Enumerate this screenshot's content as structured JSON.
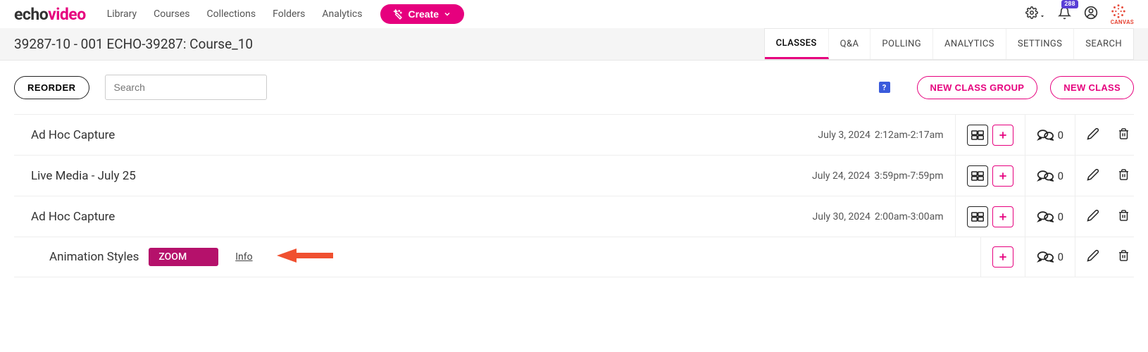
{
  "brand": {
    "part1": "echo",
    "part2": "video"
  },
  "nav": {
    "links": [
      "Library",
      "Courses",
      "Collections",
      "Folders",
      "Analytics"
    ],
    "create_label": "Create",
    "notif_count": "288"
  },
  "course": {
    "title": "39287-10 - 001 ECHO-39287: Course_10",
    "tabs": [
      "CLASSES",
      "Q&A",
      "POLLING",
      "ANALYTICS",
      "SETTINGS",
      "SEARCH"
    ],
    "active_tab": "CLASSES"
  },
  "toolbar": {
    "reorder_label": "REORDER",
    "search_placeholder": "Search",
    "help_label": "?",
    "new_group_label": "NEW CLASS GROUP",
    "new_class_label": "NEW CLASS"
  },
  "rows": [
    {
      "title": "Ad Hoc Capture",
      "date": "July 3, 2024",
      "time": "2:12am-2:17am",
      "comments": "0",
      "has_media": true,
      "indent": false
    },
    {
      "title": "Live Media - July 25",
      "date": "July 24, 2024",
      "time": "3:59pm-7:59pm",
      "comments": "0",
      "has_media": true,
      "indent": false
    },
    {
      "title": "Ad Hoc Capture",
      "date": "July 30, 2024",
      "time": "2:00am-3:00am",
      "comments": "0",
      "has_media": true,
      "indent": false
    },
    {
      "title": "Animation Styles",
      "zoom": "ZOOM",
      "info": "Info",
      "comments": "0",
      "has_media": false,
      "indent": true,
      "arrow": true
    }
  ],
  "canvas_label": "CANVAS"
}
